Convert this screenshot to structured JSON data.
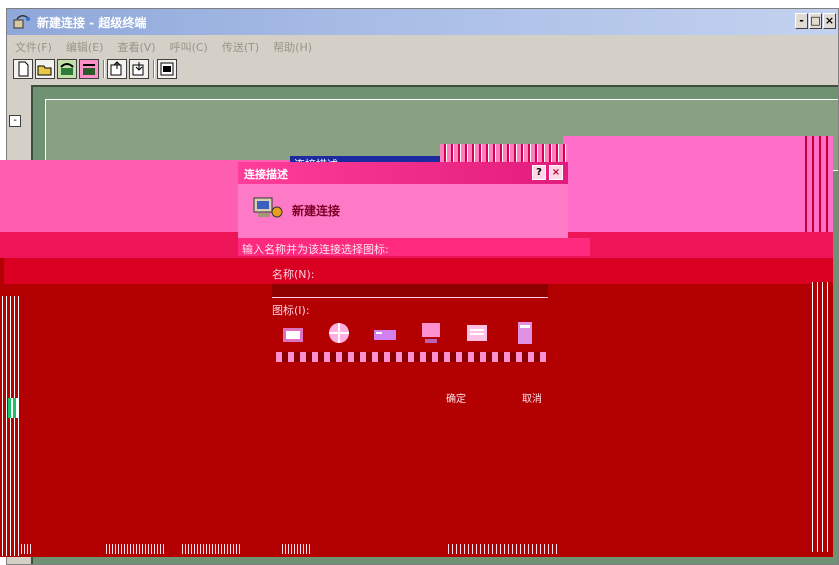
{
  "window": {
    "title": "新建连接 - 超级终端",
    "controls": {
      "minimize": "-",
      "maximize": "□",
      "close": "×"
    }
  },
  "menubar": {
    "items": [
      "文件(F)",
      "编辑(E)",
      "查看(V)",
      "呼叫(C)",
      "传送(T)",
      "帮助(H)"
    ]
  },
  "toolbar": {
    "buttons": [
      "new-icon",
      "open-icon",
      "phone-icon",
      "disconnect-icon",
      "send-icon",
      "receive-icon",
      "properties-icon"
    ]
  },
  "dialog": {
    "title": "连接描述",
    "back_tab_title": "连接描述",
    "help": "?",
    "close": "×",
    "connection_name": "新建连接",
    "prompt": "输入名称并为该连接选择图标:",
    "name_label": "名称(N):",
    "icon_label": "图标(I):",
    "ok_label": "确定",
    "cancel_label": "取消"
  },
  "colors": {
    "title_gradient": "#8fa7d9",
    "dialog_title": "#ff3d9a",
    "background_red": "#b30000",
    "panel_green": "#6f9372"
  }
}
